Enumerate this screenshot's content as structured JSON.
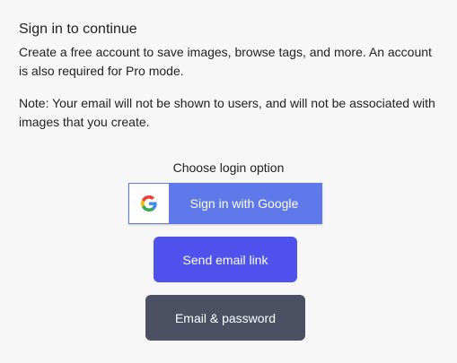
{
  "header": {
    "title": "Sign in to continue",
    "description": "Create a free account to save images, browse tags, and more. An account is also required for Pro mode.",
    "note": "Note: Your email will not be shown to users, and will not be associated with images that you create."
  },
  "login": {
    "prompt": "Choose login option",
    "google_label": "Sign in with Google",
    "email_link_label": "Send email link",
    "email_password_label": "Email & password"
  },
  "icons": {
    "google": "google-icon"
  },
  "colors": {
    "background": "#f7f7f7",
    "google_button": "#6079ea",
    "email_link_button": "#4f52ec",
    "email_password_button": "#4b5162"
  }
}
